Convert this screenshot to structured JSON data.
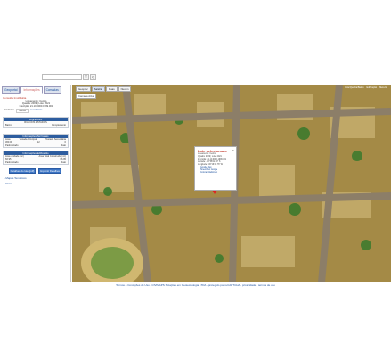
{
  "search": {
    "placeholder": ""
  },
  "left_panel": {
    "tabs": [
      "Geoportal",
      "Informações",
      "Camadas"
    ],
    "lote_link": "Consulta Imobiliária",
    "lote_info": [
      "Loteamento: Centro",
      "Quadra: 2009 | Lote: 2021",
      "Inscrição: 21.10.0000.1999.001"
    ],
    "cadastro_label": "Cadastro:",
    "cadastro_value": "Centro",
    "cadastro_extra": "2 cadastros",
    "logradouro": {
      "header": "Logradouro",
      "value": "RUA DOS ESTADOS"
    },
    "bairro_label": "Bairro",
    "complemento_label": "Complemento",
    "territorial": {
      "header": "Informações Territoriais",
      "cols": [
        "Área",
        "Testada Principal",
        "Testada Secundária"
      ],
      "vals": [
        "360,00",
        "12",
        "0"
      ],
      "padrao": [
        "Padronizado",
        "Fato"
      ]
    },
    "area": {
      "header": "Informações Edificação",
      "cols": [
        "Área unidade (m²)",
        "Área Total Construída (m²)"
      ],
      "vals": [
        "66,95",
        "66,95"
      ],
      "padrao": [
        "Padronizado",
        "Fato"
      ]
    },
    "buttons": [
      "Detalhes do lote (pdf)",
      "Imprimir Detalhes"
    ],
    "links": [
      "Mapas Temáticos",
      "Rotas"
    ]
  },
  "map": {
    "tabs": [
      "Geoproc",
      "Satélite",
      "Ruas",
      "Nuvem"
    ],
    "subtab": "Camada Ativa",
    "legend": [
      "Lote/Quadra/Bairro",
      "Edificação",
      "Meio-fio"
    ],
    "popup": {
      "title": "Lote selecionado",
      "lines": [
        "Loteamento: Centro",
        "Quadra: 2009 | Lote: 2021",
        "Inscrição: 21.10.0000.1999.001",
        "Latitude: -16°38'22.49\" S",
        "Longitude: -49°16'41.76\" W"
      ],
      "links": [
        "Google Map",
        "StreetView Google",
        "Colocar Maddovec"
      ]
    }
  },
  "footer": "Termos e Condições de Uso - CIVIMAPS Soluções em Geotecnologia LTDA - protegido por reCAPTCHA - privacidade - termos de uso"
}
